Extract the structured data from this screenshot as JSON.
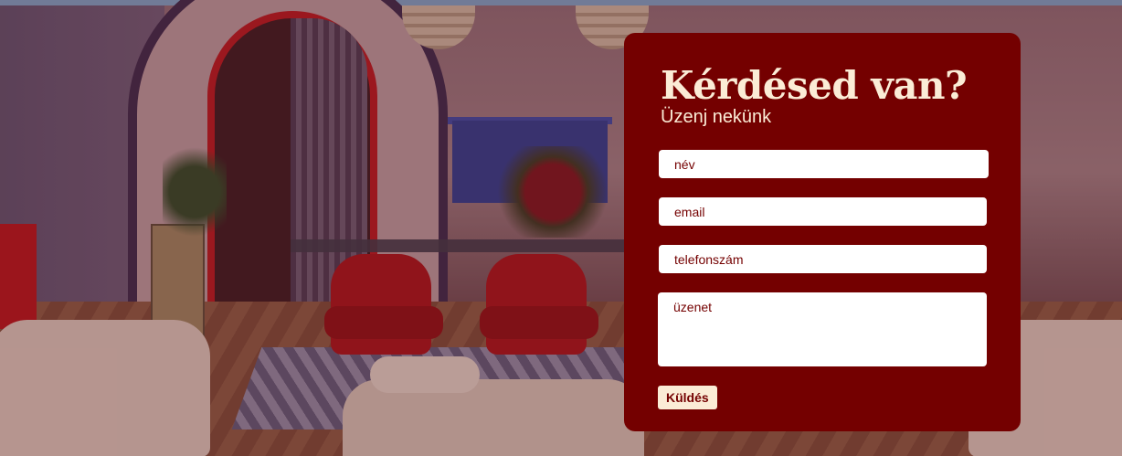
{
  "contact_form": {
    "title": "Kérdésed van?",
    "subtitle": "Üzenj nekünk",
    "name_placeholder": "név",
    "email_placeholder": "email",
    "phone_placeholder": "telefonszám",
    "message_placeholder": "üzenet",
    "submit_label": "Küldés"
  },
  "colors": {
    "card_background": "#740000",
    "accent_cream": "#fbecd6",
    "top_strip": "#7aa3c8"
  }
}
